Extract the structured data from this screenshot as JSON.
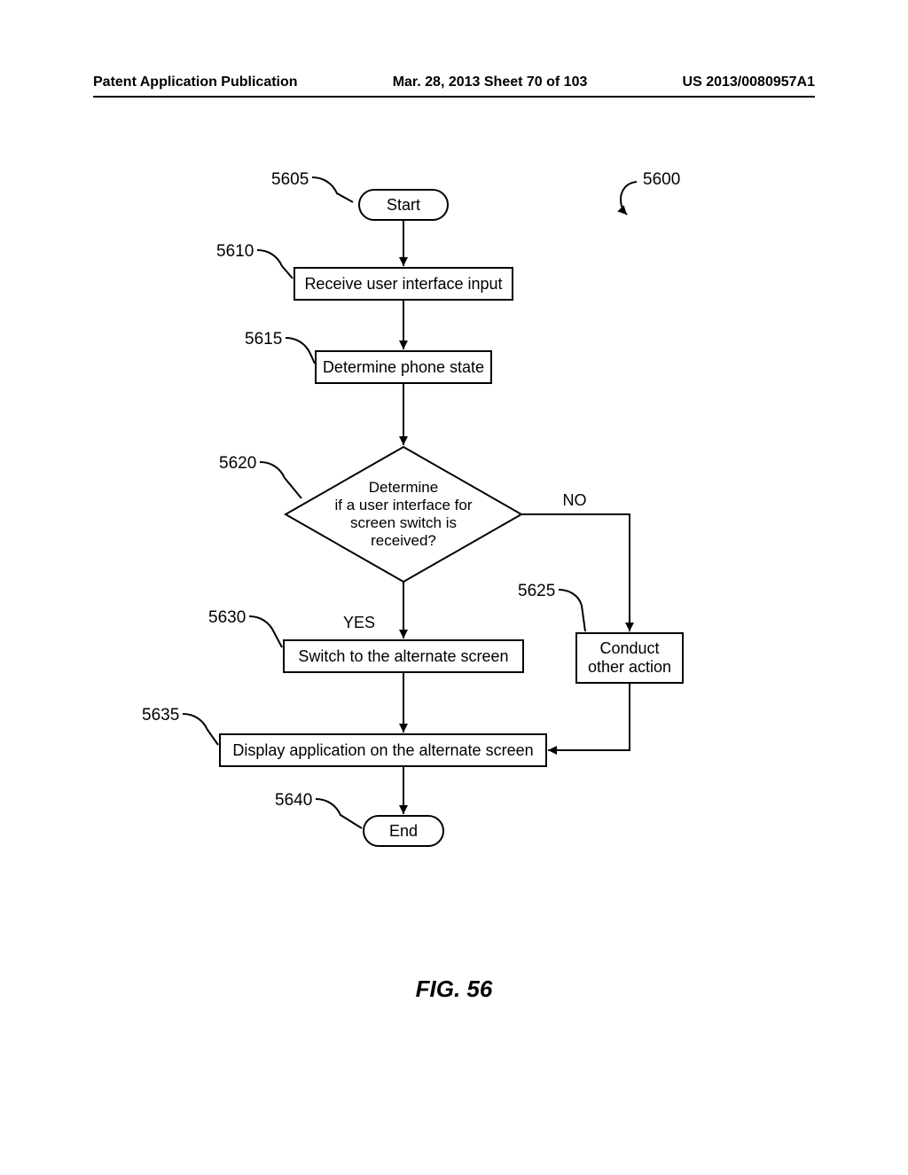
{
  "header": {
    "left": "Patent Application Publication",
    "center": "Mar. 28, 2013  Sheet 70 of 103",
    "right": "US 2013/0080957A1"
  },
  "figure": {
    "caption": "FIG. 56",
    "ref_overall": "5600",
    "steps": {
      "start": {
        "ref": "5605",
        "text": "Start"
      },
      "receive": {
        "ref": "5610",
        "text": "Receive user interface input"
      },
      "state": {
        "ref": "5615",
        "text": "Determine phone state"
      },
      "decide": {
        "ref": "5620",
        "line1": "Determine",
        "line2": "if a user interface for",
        "line3": "screen switch is",
        "line4": "received?"
      },
      "no_label": "NO",
      "yes_label": "YES",
      "alt": {
        "ref": "5625",
        "line1": "Conduct",
        "line2": "other action"
      },
      "switch": {
        "ref": "5630",
        "text": "Switch to the alternate screen"
      },
      "display": {
        "ref": "5635",
        "text": "Display application on the alternate screen"
      },
      "end": {
        "ref": "5640",
        "text": "End"
      }
    }
  }
}
